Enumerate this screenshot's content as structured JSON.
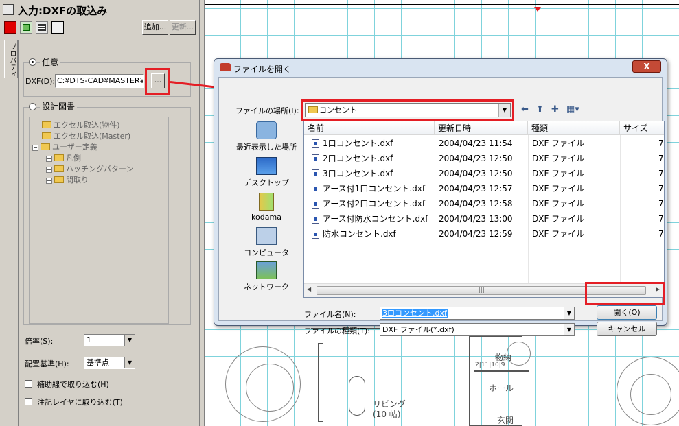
{
  "left_panel": {
    "title": "入力:DXFの取込み",
    "toolbar": {
      "add_label": "追加...",
      "update_label": "更新..."
    },
    "side_tab": "プロパティ",
    "any_option": {
      "label": "任意",
      "selected": true
    },
    "dxf_label": "DXF(D):",
    "dxf_path": "C:¥DTS-CAD¥MASTER¥部",
    "browse_label": "...",
    "design_option": {
      "label": "設計図書",
      "selected": false
    },
    "tree": [
      {
        "label": "エクセル取込(物件)",
        "expander": ""
      },
      {
        "label": "エクセル取込(Master)",
        "expander": ""
      },
      {
        "label": "ユーザー定義",
        "expander": "−"
      },
      {
        "label": "凡例",
        "expander": "+"
      },
      {
        "label": "ハッチングパターン",
        "expander": "+"
      },
      {
        "label": "間取り",
        "expander": "+"
      }
    ],
    "scale_label": "倍率(S):",
    "scale_value": "1",
    "base_label": "配置基準(H):",
    "base_value": "基準点",
    "chk_aux_label": "補助線で取り込む(H)",
    "chk_note_label": "注記レイヤに取り込む(T)"
  },
  "canvas": {
    "room_living": "リビング",
    "room_living_size": "(10 帖)",
    "room_hall": "ホール",
    "room_entrance": "玄関",
    "room_storage": "物納",
    "room_misc": "2|11|10|9"
  },
  "dialog": {
    "title": "ファイルを開く",
    "close_label": "X",
    "location_label": "ファイルの場所(I):",
    "location_value": "コンセント",
    "places": [
      "最近表示した場所",
      "デスクトップ",
      "kodama",
      "コンピュータ",
      "ネットワーク"
    ],
    "columns": [
      "名前",
      "更新日時",
      "種類",
      "サイズ"
    ],
    "files": [
      {
        "name": "1口コンセント.dxf",
        "date": "2004/04/23 11:54",
        "type": "DXF ファイル",
        "size": "7"
      },
      {
        "name": "2口コンセント.dxf",
        "date": "2004/04/23 12:50",
        "type": "DXF ファイル",
        "size": "7"
      },
      {
        "name": "3口コンセント.dxf",
        "date": "2004/04/23 12:50",
        "type": "DXF ファイル",
        "size": "7"
      },
      {
        "name": "アース付1口コンセント.dxf",
        "date": "2004/04/23 12:57",
        "type": "DXF ファイル",
        "size": "7"
      },
      {
        "name": "アース付2口コンセント.dxf",
        "date": "2004/04/23 12:58",
        "type": "DXF ファイル",
        "size": "7"
      },
      {
        "name": "アース付防水コンセント.dxf",
        "date": "2004/04/23 13:00",
        "type": "DXF ファイル",
        "size": "7"
      },
      {
        "name": "防水コンセント.dxf",
        "date": "2004/04/23 12:59",
        "type": "DXF ファイル",
        "size": "7"
      }
    ],
    "filename_label": "ファイル名(N):",
    "filename_value": "3口コンセント.dxf",
    "filetype_label": "ファイルの種類(T):",
    "filetype_value": "DXF ファイル(*.dxf)",
    "open_label": "開く(O)",
    "cancel_label": "キャンセル"
  },
  "colors": {
    "highlight": "#e41e25",
    "grid": "#7fd3dc"
  }
}
